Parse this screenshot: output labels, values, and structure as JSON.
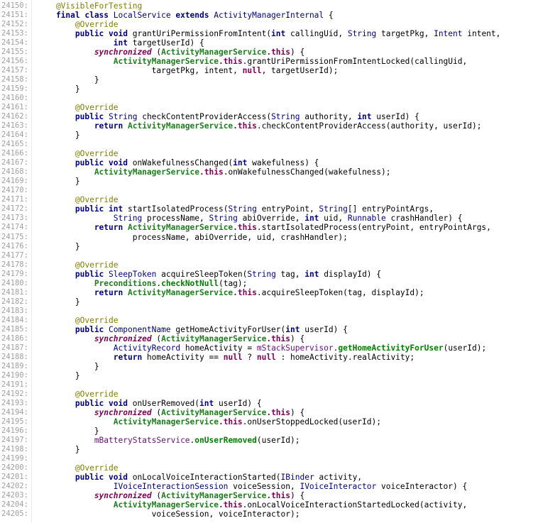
{
  "colors": {
    "annotation": "#808000",
    "keyword": "#000080",
    "keyword_this": "#7f0055",
    "class_ref": "#1e7e1e",
    "field": "#660e7a",
    "line_number": "#a0a0a0"
  },
  "lines": [
    {
      "n": "24150:",
      "t": [
        [
          "ann",
          "    @VisibleForTesting"
        ]
      ]
    },
    {
      "n": "24151:",
      "t": [
        [
          "kw",
          "    final class "
        ],
        [
          "typ",
          "LocalService"
        ],
        [
          "kw",
          " extends "
        ],
        [
          "typ",
          "ActivityManagerInternal"
        ],
        [
          "plain",
          " {"
        ]
      ]
    },
    {
      "n": "24152:",
      "t": [
        [
          "ann",
          "        @Override"
        ]
      ]
    },
    {
      "n": "24153:",
      "t": [
        [
          "kw",
          "        public void "
        ],
        [
          "plain",
          "grantUriPermissionFromIntent("
        ],
        [
          "kw",
          "int "
        ],
        [
          "plain",
          "callingUid, "
        ],
        [
          "typ",
          "String "
        ],
        [
          "plain",
          "targetPkg, "
        ],
        [
          "typ",
          "Intent "
        ],
        [
          "plain",
          "intent,"
        ]
      ]
    },
    {
      "n": "24154:",
      "t": [
        [
          "kw",
          "                int "
        ],
        [
          "plain",
          "targetUserId) {"
        ]
      ]
    },
    {
      "n": "24155:",
      "t": [
        [
          "kwi",
          "            synchronized "
        ],
        [
          "plain",
          "("
        ],
        [
          "cls",
          "ActivityManagerService"
        ],
        [
          "kwc",
          ".this"
        ],
        [
          "plain",
          ") {"
        ]
      ]
    },
    {
      "n": "24156:",
      "t": [
        [
          "cls",
          "                ActivityManagerService"
        ],
        [
          "kwc",
          ".this"
        ],
        [
          "plain",
          ".grantUriPermissionFromIntentLocked(callingUid,"
        ]
      ]
    },
    {
      "n": "24157:",
      "t": [
        [
          "plain",
          "                        targetPkg, intent, "
        ],
        [
          "kwc",
          "null"
        ],
        [
          "plain",
          ", targetUserId);"
        ]
      ]
    },
    {
      "n": "24158:",
      "t": [
        [
          "plain",
          "            }"
        ]
      ]
    },
    {
      "n": "24159:",
      "t": [
        [
          "plain",
          "        }"
        ]
      ]
    },
    {
      "n": "24160:",
      "t": []
    },
    {
      "n": "24161:",
      "t": [
        [
          "ann",
          "        @Override"
        ]
      ]
    },
    {
      "n": "24162:",
      "t": [
        [
          "kw",
          "        public "
        ],
        [
          "typ",
          "String "
        ],
        [
          "plain",
          "checkContentProviderAccess("
        ],
        [
          "typ",
          "String "
        ],
        [
          "plain",
          "authority, "
        ],
        [
          "kw",
          "int "
        ],
        [
          "plain",
          "userId) {"
        ]
      ]
    },
    {
      "n": "24163:",
      "t": [
        [
          "kw",
          "            return "
        ],
        [
          "cls",
          "ActivityManagerService"
        ],
        [
          "kwc",
          ".this"
        ],
        [
          "plain",
          ".checkContentProviderAccess(authority, userId);"
        ]
      ]
    },
    {
      "n": "24164:",
      "t": [
        [
          "plain",
          "        }"
        ]
      ]
    },
    {
      "n": "24165:",
      "t": []
    },
    {
      "n": "24166:",
      "t": [
        [
          "ann",
          "        @Override"
        ]
      ]
    },
    {
      "n": "24167:",
      "t": [
        [
          "kw",
          "        public void "
        ],
        [
          "plain",
          "onWakefulnessChanged("
        ],
        [
          "kw",
          "int "
        ],
        [
          "plain",
          "wakefulness) {"
        ]
      ]
    },
    {
      "n": "24168:",
      "t": [
        [
          "cls",
          "            ActivityManagerService"
        ],
        [
          "kwc",
          ".this"
        ],
        [
          "plain",
          ".onWakefulnessChanged(wakefulness);"
        ]
      ]
    },
    {
      "n": "24169:",
      "t": [
        [
          "plain",
          "        }"
        ]
      ]
    },
    {
      "n": "24170:",
      "t": []
    },
    {
      "n": "24171:",
      "t": [
        [
          "ann",
          "        @Override"
        ]
      ]
    },
    {
      "n": "24172:",
      "t": [
        [
          "kw",
          "        public int "
        ],
        [
          "plain",
          "startIsolatedProcess("
        ],
        [
          "typ",
          "String "
        ],
        [
          "plain",
          "entryPoint, "
        ],
        [
          "typ",
          "String"
        ],
        [
          "plain",
          "[] entryPointArgs,"
        ]
      ]
    },
    {
      "n": "24173:",
      "t": [
        [
          "typ",
          "                String "
        ],
        [
          "plain",
          "processName, "
        ],
        [
          "typ",
          "String "
        ],
        [
          "plain",
          "abiOverride, "
        ],
        [
          "kw",
          "int "
        ],
        [
          "plain",
          "uid, "
        ],
        [
          "typ",
          "Runnable "
        ],
        [
          "plain",
          "crashHandler) {"
        ]
      ]
    },
    {
      "n": "24174:",
      "t": [
        [
          "kw",
          "            return "
        ],
        [
          "cls",
          "ActivityManagerService"
        ],
        [
          "kwc",
          ".this"
        ],
        [
          "plain",
          ".startIsolatedProcess(entryPoint, entryPointArgs,"
        ]
      ]
    },
    {
      "n": "24175:",
      "t": [
        [
          "plain",
          "                    processName, abiOverride, uid, crashHandler);"
        ]
      ]
    },
    {
      "n": "24176:",
      "t": [
        [
          "plain",
          "        }"
        ]
      ]
    },
    {
      "n": "24177:",
      "t": []
    },
    {
      "n": "24178:",
      "t": [
        [
          "ann",
          "        @Override"
        ]
      ]
    },
    {
      "n": "24179:",
      "t": [
        [
          "kw",
          "        public "
        ],
        [
          "typ",
          "SleepToken "
        ],
        [
          "plain",
          "acquireSleepToken("
        ],
        [
          "typ",
          "String "
        ],
        [
          "plain",
          "tag, "
        ],
        [
          "kw",
          "int "
        ],
        [
          "plain",
          "displayId) {"
        ]
      ]
    },
    {
      "n": "24180:",
      "t": [
        [
          "cls",
          "            Preconditions"
        ],
        [
          "plain",
          "."
        ],
        [
          "mth",
          "checkNotNull"
        ],
        [
          "plain",
          "(tag);"
        ]
      ]
    },
    {
      "n": "24181:",
      "t": [
        [
          "kw",
          "            return "
        ],
        [
          "cls",
          "ActivityManagerService"
        ],
        [
          "kwc",
          ".this"
        ],
        [
          "plain",
          ".acquireSleepToken(tag, displayId);"
        ]
      ]
    },
    {
      "n": "24182:",
      "t": [
        [
          "plain",
          "        }"
        ]
      ]
    },
    {
      "n": "24183:",
      "t": []
    },
    {
      "n": "24184:",
      "t": [
        [
          "ann",
          "        @Override"
        ]
      ]
    },
    {
      "n": "24185:",
      "t": [
        [
          "kw",
          "        public "
        ],
        [
          "typ",
          "ComponentName "
        ],
        [
          "plain",
          "getHomeActivityForUser("
        ],
        [
          "kw",
          "int "
        ],
        [
          "plain",
          "userId) {"
        ]
      ]
    },
    {
      "n": "24186:",
      "t": [
        [
          "kwi",
          "            synchronized "
        ],
        [
          "plain",
          "("
        ],
        [
          "cls",
          "ActivityManagerService"
        ],
        [
          "kwc",
          ".this"
        ],
        [
          "plain",
          ") {"
        ]
      ]
    },
    {
      "n": "24187:",
      "t": [
        [
          "typ",
          "                ActivityRecord "
        ],
        [
          "plain",
          "homeActivity = "
        ],
        [
          "fld",
          "mStackSupervisor"
        ],
        [
          "plain",
          "."
        ],
        [
          "mth",
          "getHomeActivityForUser"
        ],
        [
          "plain",
          "(userId);"
        ]
      ]
    },
    {
      "n": "24188:",
      "t": [
        [
          "kw",
          "                return "
        ],
        [
          "plain",
          "homeActivity == "
        ],
        [
          "kwc",
          "null"
        ],
        [
          "plain",
          " ? "
        ],
        [
          "kwc",
          "null"
        ],
        [
          "plain",
          " : homeActivity.realActivity;"
        ]
      ]
    },
    {
      "n": "24189:",
      "t": [
        [
          "plain",
          "            }"
        ]
      ]
    },
    {
      "n": "24190:",
      "t": [
        [
          "plain",
          "        }"
        ]
      ]
    },
    {
      "n": "24191:",
      "t": []
    },
    {
      "n": "24192:",
      "t": [
        [
          "ann",
          "        @Override"
        ]
      ]
    },
    {
      "n": "24193:",
      "t": [
        [
          "kw",
          "        public void "
        ],
        [
          "plain",
          "onUserRemoved("
        ],
        [
          "kw",
          "int "
        ],
        [
          "plain",
          "userId) {"
        ]
      ]
    },
    {
      "n": "24194:",
      "t": [
        [
          "kwi",
          "            synchronized "
        ],
        [
          "plain",
          "("
        ],
        [
          "cls",
          "ActivityManagerService"
        ],
        [
          "kwc",
          ".this"
        ],
        [
          "plain",
          ") {"
        ]
      ]
    },
    {
      "n": "24195:",
      "t": [
        [
          "cls",
          "                ActivityManagerService"
        ],
        [
          "kwc",
          ".this"
        ],
        [
          "plain",
          ".onUserStoppedLocked(userId);"
        ]
      ]
    },
    {
      "n": "24196:",
      "t": [
        [
          "plain",
          "            }"
        ]
      ]
    },
    {
      "n": "24197:",
      "t": [
        [
          "fld",
          "            mBatteryStatsService"
        ],
        [
          "plain",
          "."
        ],
        [
          "mth",
          "onUserRemoved"
        ],
        [
          "plain",
          "(userId);"
        ]
      ]
    },
    {
      "n": "24198:",
      "t": [
        [
          "plain",
          "        }"
        ]
      ]
    },
    {
      "n": "24199:",
      "t": []
    },
    {
      "n": "24200:",
      "t": [
        [
          "ann",
          "        @Override"
        ]
      ]
    },
    {
      "n": "24201:",
      "t": [
        [
          "kw",
          "        public void "
        ],
        [
          "plain",
          "onLocalVoiceInteractionStarted("
        ],
        [
          "typ",
          "IBinder "
        ],
        [
          "plain",
          "activity,"
        ]
      ]
    },
    {
      "n": "24202:",
      "t": [
        [
          "typ",
          "                IVoiceInteractionSession "
        ],
        [
          "plain",
          "voiceSession, "
        ],
        [
          "typ",
          "IVoiceInteractor "
        ],
        [
          "plain",
          "voiceInteractor) {"
        ]
      ]
    },
    {
      "n": "24203:",
      "t": [
        [
          "kwi",
          "            synchronized "
        ],
        [
          "plain",
          "("
        ],
        [
          "cls",
          "ActivityManagerService"
        ],
        [
          "kwc",
          ".this"
        ],
        [
          "plain",
          ") {"
        ]
      ]
    },
    {
      "n": "24204:",
      "t": [
        [
          "cls",
          "                ActivityManagerService"
        ],
        [
          "kwc",
          ".this"
        ],
        [
          "plain",
          ".onLocalVoiceInteractionStartedLocked(activity,"
        ]
      ]
    },
    {
      "n": "24205:",
      "t": [
        [
          "plain",
          "                        voiceSession, voiceInteractor);"
        ]
      ]
    }
  ]
}
